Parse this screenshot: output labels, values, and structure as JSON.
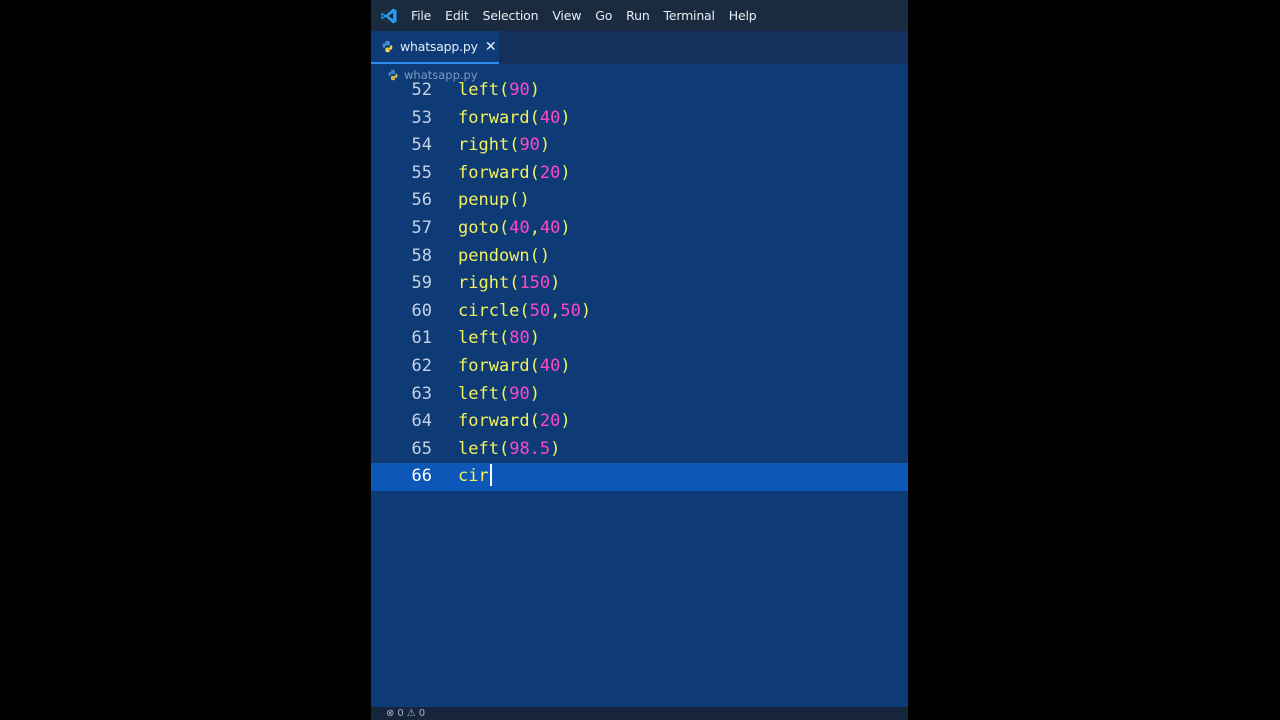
{
  "menubar": {
    "items": [
      "File",
      "Edit",
      "Selection",
      "View",
      "Go",
      "Run",
      "Terminal",
      "Help"
    ]
  },
  "tab": {
    "title": "whatsapp.py",
    "close_glyph": "✕"
  },
  "breadcrumb": {
    "file": "whatsapp.py"
  },
  "editor": {
    "current_line": 66,
    "lines": [
      {
        "n": "52",
        "fn": "left",
        "args": [
          [
            "num",
            "90"
          ]
        ]
      },
      {
        "n": "53",
        "fn": "forward",
        "args": [
          [
            "num",
            "40"
          ]
        ]
      },
      {
        "n": "54",
        "fn": "right",
        "args": [
          [
            "num",
            "90"
          ]
        ]
      },
      {
        "n": "55",
        "fn": "forward",
        "args": [
          [
            "num",
            "20"
          ]
        ]
      },
      {
        "n": "56",
        "fn": "penup",
        "args": []
      },
      {
        "n": "57",
        "fn": "goto",
        "args": [
          [
            "num",
            "40"
          ],
          [
            "pn",
            ","
          ],
          [
            "num",
            "40"
          ]
        ]
      },
      {
        "n": "58",
        "fn": "pendown",
        "args": []
      },
      {
        "n": "59",
        "fn": "right",
        "args": [
          [
            "num",
            "150"
          ]
        ]
      },
      {
        "n": "60",
        "fn": "circle",
        "args": [
          [
            "num",
            "50"
          ],
          [
            "pn",
            ","
          ],
          [
            "num",
            "50"
          ]
        ]
      },
      {
        "n": "61",
        "fn": "left",
        "args": [
          [
            "num",
            "80"
          ]
        ]
      },
      {
        "n": "62",
        "fn": "forward",
        "args": [
          [
            "num",
            "40"
          ]
        ]
      },
      {
        "n": "63",
        "fn": "left",
        "args": [
          [
            "num",
            "90"
          ]
        ]
      },
      {
        "n": "64",
        "fn": "forward",
        "args": [
          [
            "num",
            "20"
          ]
        ]
      },
      {
        "n": "65",
        "fn": "left",
        "args": [
          [
            "num",
            "98.5"
          ]
        ]
      },
      {
        "n": "66",
        "typed": "cir"
      }
    ]
  },
  "statusbar": {
    "errors": "0",
    "warnings": "0"
  },
  "colors": {
    "editor_bg": "#0e3a76",
    "current_line": "#0d57b8",
    "function": "#f3f25f",
    "number": "#ff49c8"
  }
}
